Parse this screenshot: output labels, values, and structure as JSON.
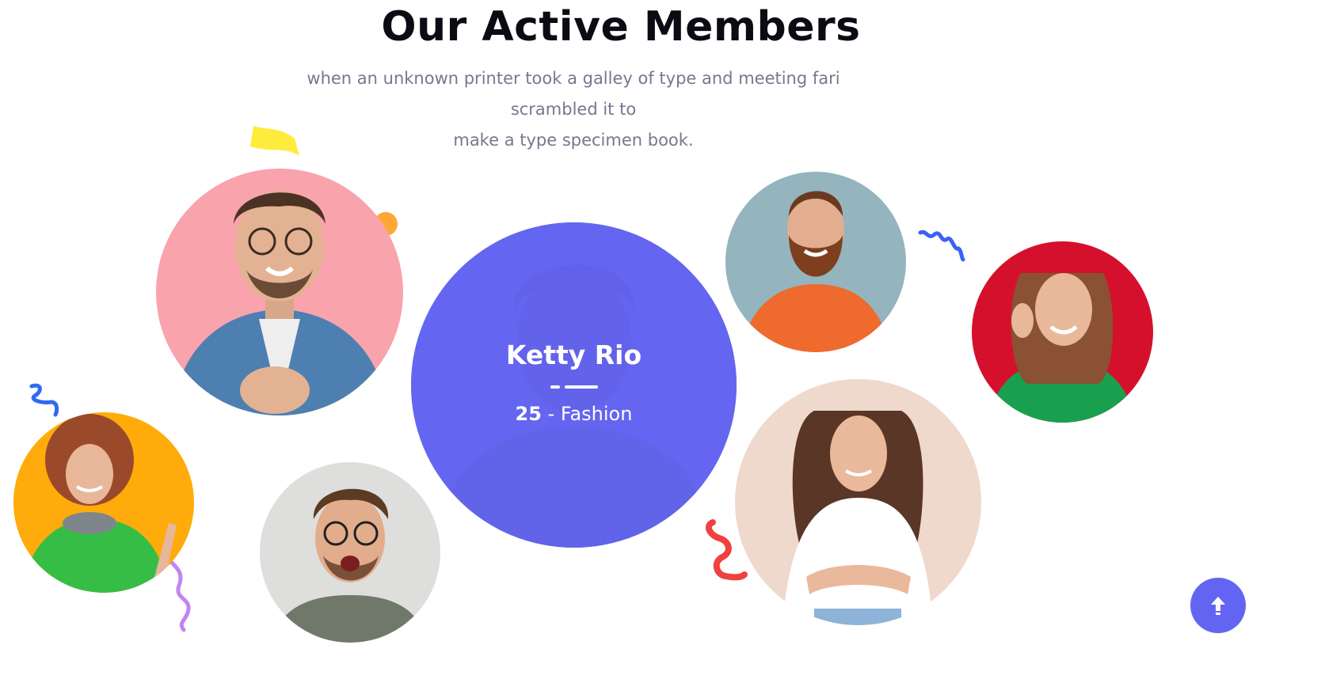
{
  "section": {
    "title": "Our Active Members",
    "subtitle_line1": "when an unknown printer took a galley of type and meeting fari scrambled it to",
    "subtitle_line2": "make a type specimen book."
  },
  "featured_member": {
    "name": "Ketty Rio",
    "age": "25",
    "separator": " - ",
    "category": "Fashion"
  },
  "members": [
    {
      "id": "man-glasses-denim",
      "bg": "#f9a3ad"
    },
    {
      "id": "woman-curly-headphones",
      "bg": "#ffab0b"
    },
    {
      "id": "man-glasses-green-shirt",
      "bg": "#dededc"
    },
    {
      "id": "man-beard-orange",
      "bg": "#94b4be"
    },
    {
      "id": "woman-white-tshirt",
      "bg": "#efd9cc"
    },
    {
      "id": "woman-green-sweater",
      "bg": "#d5102c"
    }
  ],
  "colors": {
    "accent": "#6365f2",
    "title": "#0b0b14",
    "subtitle": "#77778e"
  },
  "icons": {
    "scroll_top": "arrow-up-icon"
  }
}
